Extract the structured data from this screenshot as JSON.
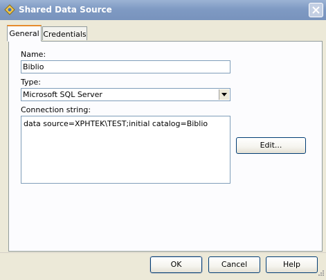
{
  "window": {
    "title": "Shared Data Source"
  },
  "tabs": [
    {
      "label": "General",
      "selected": true
    },
    {
      "label": "Credentials",
      "selected": false
    }
  ],
  "form": {
    "name_label": "Name:",
    "name_value": "Biblio",
    "type_label": "Type:",
    "type_value": "Microsoft SQL Server",
    "connection_label": "Connection string:",
    "connection_value": "data source=XPHTEK\\TEST;initial catalog=Biblio",
    "edit_button": "Edit..."
  },
  "buttons": {
    "ok": "OK",
    "cancel": "Cancel",
    "help": "Help"
  },
  "icons": {
    "app": "data-source-icon",
    "close": "close-icon",
    "dropdown": "chevron-down-icon",
    "grip": "resize-grip-icon"
  },
  "colors": {
    "titlebar": "#7f9ac3",
    "tab_highlight": "#e68b2c",
    "button_border": "#003c74"
  }
}
